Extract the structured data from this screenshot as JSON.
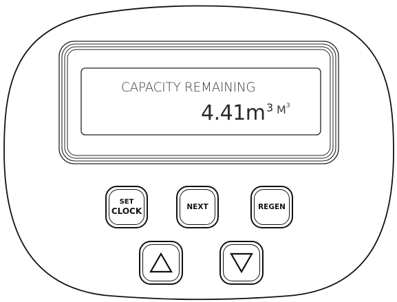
{
  "display": {
    "title": "CAPACITY REMAINING",
    "value": "4.41",
    "value_unit": "m",
    "value_unit_exp": "3",
    "unit_label": "M",
    "unit_label_exp": "3"
  },
  "buttons": {
    "set_clock_line1": "SET",
    "set_clock_line2": "CLOCK",
    "next": "NEXT",
    "regen": "REGEN",
    "up_icon": "up-triangle-icon",
    "down_icon": "down-triangle-icon"
  },
  "colors": {
    "outline": "#111111",
    "lcd_text": "#2f2f2f",
    "background": "#ffffff"
  }
}
